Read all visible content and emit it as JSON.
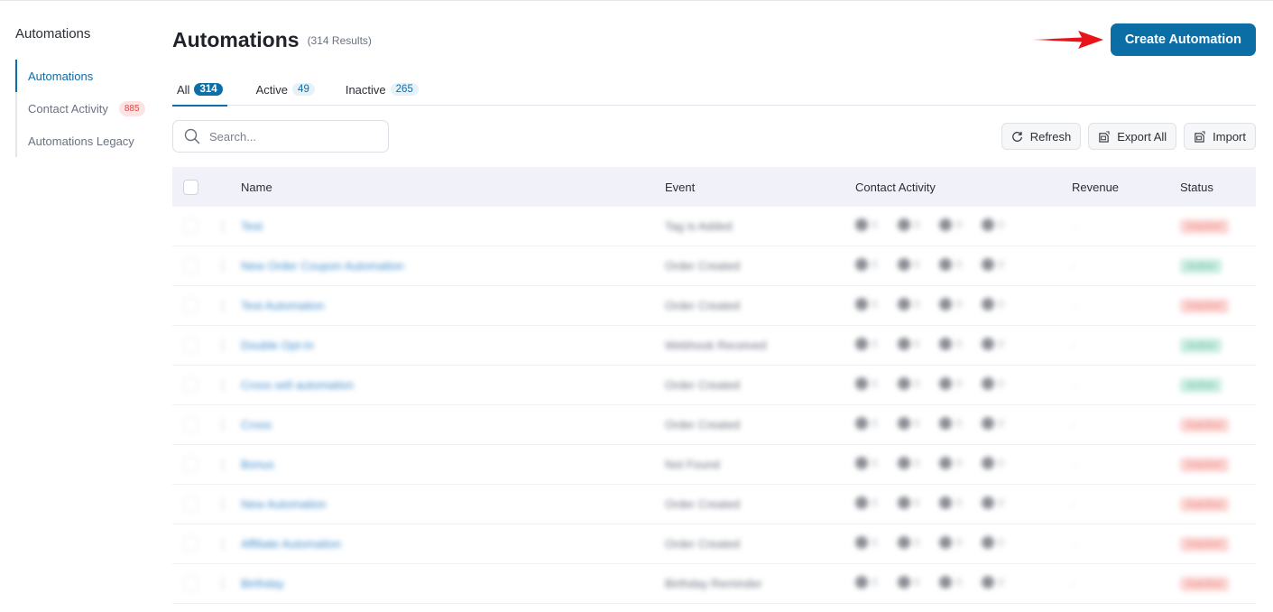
{
  "sidebar": {
    "title": "Automations",
    "items": [
      {
        "label": "Automations",
        "active": true
      },
      {
        "label": "Contact Activity",
        "badge": "885"
      },
      {
        "label": "Automations Legacy"
      }
    ]
  },
  "header": {
    "title": "Automations",
    "results": "(314 Results)",
    "create_label": "Create Automation"
  },
  "tabs": [
    {
      "label": "All",
      "count": "314",
      "active": true
    },
    {
      "label": "Active",
      "count": "49"
    },
    {
      "label": "Inactive",
      "count": "265"
    }
  ],
  "toolbar": {
    "search_placeholder": "Search...",
    "refresh_label": "Refresh",
    "export_label": "Export All",
    "import_label": "Import"
  },
  "table": {
    "columns": [
      "Name",
      "Event",
      "Contact Activity",
      "Revenue",
      "Status"
    ],
    "rows": [
      {
        "name": "Test",
        "event": "Tag is Added",
        "activity": [
          "0",
          "0",
          "0",
          "0"
        ],
        "revenue": "-",
        "status": "Inactive",
        "status_type": "inactive"
      },
      {
        "name": "New Order Coupon Automation",
        "event": "Order Created",
        "activity": [
          "0",
          "0",
          "0",
          "0"
        ],
        "revenue": "-",
        "status": "Active",
        "status_type": "active"
      },
      {
        "name": "Test Automation",
        "event": "Order Created",
        "activity": [
          "0",
          "0",
          "0",
          "0"
        ],
        "revenue": "-",
        "status": "Inactive",
        "status_type": "inactive"
      },
      {
        "name": "Double Opt-In",
        "event": "Webhook Received",
        "activity": [
          "0",
          "0",
          "0",
          "0"
        ],
        "revenue": "-",
        "status": "Active",
        "status_type": "active"
      },
      {
        "name": "Cross sell automation",
        "event": "Order Created",
        "activity": [
          "0",
          "0",
          "0",
          "0"
        ],
        "revenue": "-",
        "status": "Active",
        "status_type": "active"
      },
      {
        "name": "Cross",
        "event": "Order Created",
        "activity": [
          "0",
          "0",
          "0",
          "0"
        ],
        "revenue": "-",
        "status": "Inactive",
        "status_type": "inactive"
      },
      {
        "name": "Bonus",
        "event": "Not Found",
        "activity": [
          "0",
          "0",
          "0",
          "0"
        ],
        "revenue": "-",
        "status": "Inactive",
        "status_type": "inactive"
      },
      {
        "name": "New Automation",
        "event": "Order Created",
        "activity": [
          "0",
          "0",
          "0",
          "0"
        ],
        "revenue": "-",
        "status": "Inactive",
        "status_type": "inactive"
      },
      {
        "name": "Affiliate Automation",
        "event": "Order Created",
        "activity": [
          "0",
          "0",
          "0",
          "0"
        ],
        "revenue": "-",
        "status": "Inactive",
        "status_type": "inactive"
      },
      {
        "name": "Birthday",
        "event": "Birthday Reminder",
        "activity": [
          "0",
          "0",
          "0",
          "0"
        ],
        "revenue": "-",
        "status": "Inactive",
        "status_type": "inactive"
      }
    ]
  },
  "colors": {
    "brand": "#0b6fa6",
    "active_status": "#c9ece1",
    "inactive_status": "#fbd4d2",
    "annotation_arrow": "#e8141a"
  }
}
